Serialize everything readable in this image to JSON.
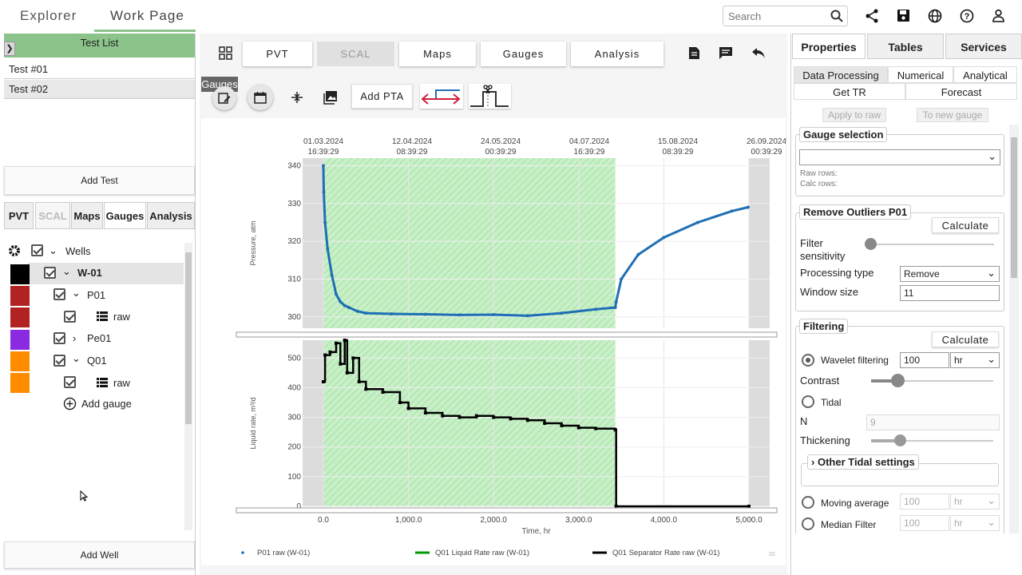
{
  "topnav": {
    "tabs": [
      "Explorer",
      "Work Page"
    ],
    "search_placeholder": "Search",
    "icons": [
      "search-icon",
      "share-icon",
      "save-icon",
      "globe-icon",
      "help-icon",
      "user-icon"
    ]
  },
  "left": {
    "header": "Test List",
    "tests": [
      "Test #01",
      "Test #02"
    ],
    "add_test": "Add Test",
    "tabs": [
      "PVT",
      "SCAL",
      "Maps",
      "Gauges",
      "Analysis"
    ],
    "tree": {
      "root": "Wells",
      "well": "W-01",
      "p01": "P01",
      "raw1": "raw",
      "pe01": "Pe01",
      "q01": "Q01",
      "raw2": "raw",
      "add_gauge": "Add gauge"
    },
    "add_well": "Add Well",
    "swatch_colors": [
      "#000000",
      "#b22222",
      "#b22222",
      "#8a2be2",
      "#ff8c00",
      "#ff8c00"
    ]
  },
  "center": {
    "tabs": [
      "PVT",
      "SCAL",
      "Maps",
      "Gauges",
      "Analysis"
    ],
    "tooltip": "Gauges",
    "add_pta": "Add PTA"
  },
  "chart_data": {
    "type": "line",
    "top_dates": [
      "01.03.2024\n16:39:29",
      "12.04.2024\n08:39:29",
      "24.05.2024\n00:39:29",
      "04.07.2024\n16:39:29",
      "15.08.2024\n08:39:29",
      "26.09.2024\n00:39:29"
    ],
    "pressure": {
      "ylabel": "Pressure, atm",
      "yticks": [
        300,
        310,
        320,
        330,
        340
      ],
      "ylim": [
        297,
        342
      ],
      "x": [
        0,
        5,
        20,
        50,
        100,
        150,
        200,
        250,
        300,
        400,
        500,
        800,
        1200,
        1600,
        2000,
        2400,
        2800,
        3200,
        3430,
        3440,
        3500,
        3700,
        4000,
        4400,
        4800,
        4990
      ],
      "y": [
        340,
        333,
        325,
        318,
        311,
        306,
        304,
        303,
        302.5,
        301.5,
        301,
        300.8,
        300.7,
        300.5,
        300.6,
        300.3,
        301,
        302,
        302.5,
        304,
        310,
        316.5,
        321,
        325,
        328,
        329
      ]
    },
    "rate": {
      "ylabel": "Liquid rate, m³/d",
      "yticks": [
        0,
        100,
        200,
        300,
        400,
        500
      ],
      "ylim": [
        0,
        560
      ],
      "x": [
        0,
        20,
        80,
        150,
        200,
        250,
        280,
        350,
        420,
        500,
        700,
        900,
        1000,
        1200,
        1400,
        1600,
        1800,
        2000,
        2200,
        2400,
        2600,
        2800,
        3000,
        3200,
        3430,
        3440,
        5000
      ],
      "y": [
        420,
        510,
        520,
        550,
        480,
        560,
        450,
        500,
        420,
        395,
        385,
        350,
        330,
        315,
        305,
        300,
        305,
        300,
        295,
        290,
        280,
        272,
        265,
        262,
        258,
        0,
        0
      ]
    },
    "xticks": [
      "0.0",
      "1,000.0",
      "2,000.0",
      "3,000.0",
      "4,000.0",
      "5,000.0"
    ],
    "xlim": [
      0,
      5000
    ],
    "xlabel": "Time, hr",
    "highlight_range": [
      0,
      3430
    ],
    "legend": [
      "P01 raw (W-01)",
      "Q01 Liquid Rate raw (W-01)",
      "Q01 Separator Rate raw (W-01)"
    ],
    "colors": {
      "pressure": "#1f6fb5",
      "liquid": "#009900",
      "separator": "#000000",
      "highlight": "#9fe39f"
    }
  },
  "right": {
    "tabs": [
      "Properties",
      "Tables",
      "Services"
    ],
    "subtabs": [
      "Data Processing",
      "Numerical",
      "Analytical",
      "Get TR",
      "Forecast"
    ],
    "apply_raw": "Apply to raw",
    "to_new_gauge": "To new gauge",
    "gauge_selection": "Gauge selection",
    "raw_rows": "Raw rows:",
    "calc_rows": "Calc rows:",
    "remove_outliers": "Remove Outliers P01",
    "calculate": "Calculate",
    "filter_sensitivity": "Filter sensitivity",
    "processing_type": "Processing type",
    "processing_value": "Remove",
    "window_size": "Window size",
    "window_value": "11",
    "filtering": "Filtering",
    "wavelet": "Wavelet filtering",
    "wavelet_value": "100",
    "wavelet_unit": "hr",
    "contrast": "Contrast",
    "tidal": "Tidal",
    "n_label": "N",
    "n_value": "9",
    "thickening": "Thickening",
    "other_tidal": "Other Tidal settings",
    "moving_avg": "Moving average",
    "moving_value": "100",
    "moving_unit": "hr",
    "median": "Median Filter",
    "median_value": "100",
    "median_unit": "hr"
  }
}
